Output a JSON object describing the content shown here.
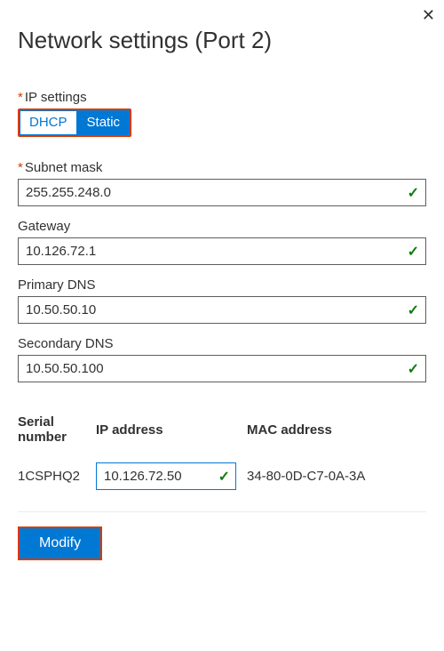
{
  "title": "Network settings (Port 2)",
  "close_glyph": "✕",
  "required_glyph": "*",
  "check_glyph": "✓",
  "ip_settings": {
    "label": "IP settings",
    "dhcp": "DHCP",
    "static": "Static",
    "selected": "Static"
  },
  "fields": {
    "subnet": {
      "label": "Subnet mask",
      "value": "255.255.248.0",
      "required": true
    },
    "gateway": {
      "label": "Gateway",
      "value": "10.126.72.1",
      "required": false
    },
    "primary_dns": {
      "label": "Primary DNS",
      "value": "10.50.50.10",
      "required": false
    },
    "secondary_dns": {
      "label": "Secondary DNS",
      "value": "10.50.50.100",
      "required": false
    }
  },
  "table": {
    "headers": {
      "serial": "Serial number",
      "ip": "IP address",
      "mac": "MAC address"
    },
    "row": {
      "serial": "1CSPHQ2",
      "ip": "10.126.72.50",
      "mac": "34-80-0D-C7-0A-3A"
    }
  },
  "modify_label": "Modify"
}
